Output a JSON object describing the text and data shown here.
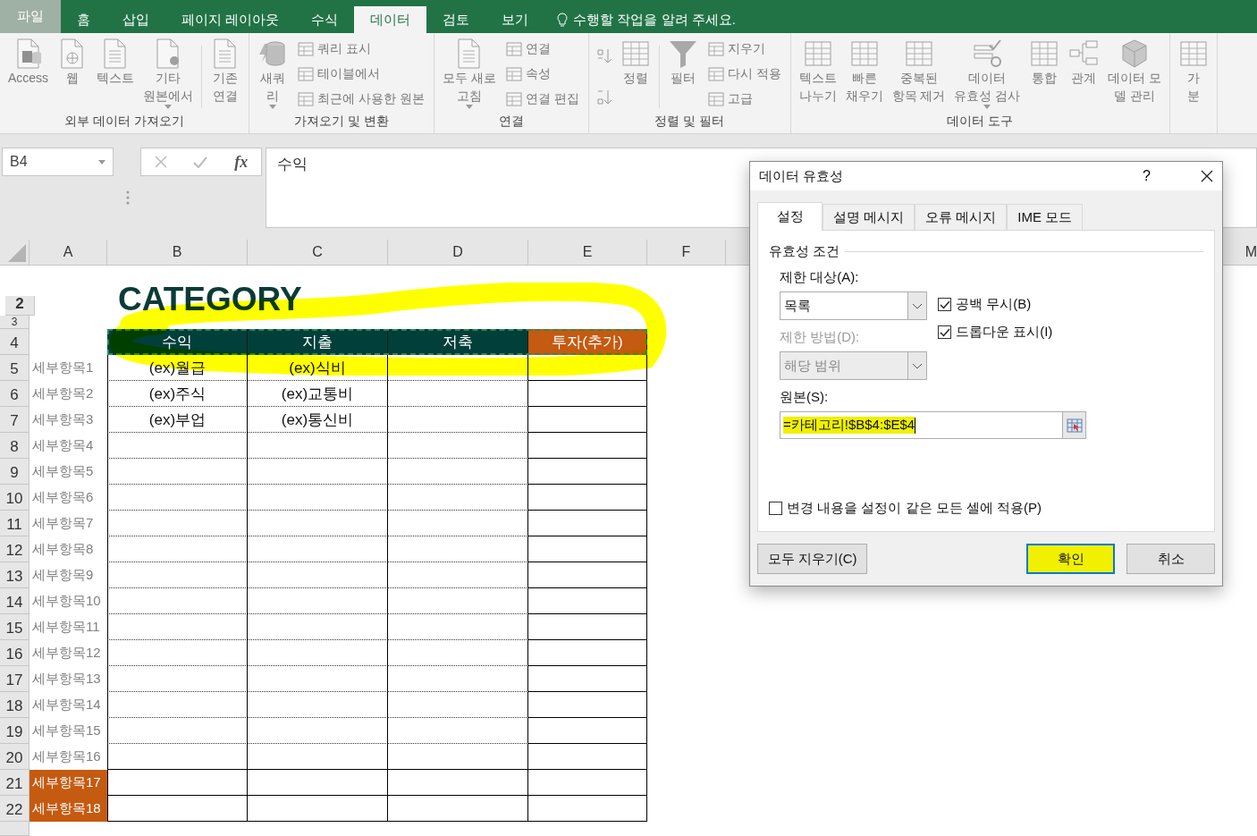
{
  "tabs": [
    {
      "label": "파일",
      "kind": "file",
      "selected": false
    },
    {
      "label": "홈",
      "kind": "tab",
      "selected": false
    },
    {
      "label": "삽입",
      "kind": "tab",
      "selected": false
    },
    {
      "label": "페이지 레이아웃",
      "kind": "tab",
      "selected": false
    },
    {
      "label": "수식",
      "kind": "tab",
      "selected": false
    },
    {
      "label": "데이터",
      "kind": "tab",
      "selected": true
    },
    {
      "label": "검토",
      "kind": "tab",
      "selected": false
    },
    {
      "label": "보기",
      "kind": "tab",
      "selected": false
    }
  ],
  "tell_me": {
    "placeholder": "수행할 작업을 알려 주세요."
  },
  "ribbon": {
    "groups": [
      {
        "label": "외부 데이터 가져오기",
        "items": [
          {
            "kind": "large",
            "label": "Access",
            "dropdown": false
          },
          {
            "kind": "large",
            "label": "웹",
            "dropdown": false
          },
          {
            "kind": "large",
            "label": "텍스트",
            "dropdown": false
          },
          {
            "kind": "large",
            "label": "기타\n원본에서",
            "dropdown": true
          },
          {
            "kind": "separator"
          },
          {
            "kind": "large",
            "label": "기존\n연결",
            "dropdown": false
          }
        ]
      },
      {
        "label": "가져오기 및 변환",
        "items": [
          {
            "kind": "large",
            "label": "새쿼\n리",
            "dropdown": true
          },
          {
            "kind": "stack",
            "items": [
              {
                "label": "쿼리 표시"
              },
              {
                "label": "테이블에서"
              },
              {
                "label": "최근에 사용한 원본"
              }
            ]
          }
        ]
      },
      {
        "label": "연결",
        "items": [
          {
            "kind": "large",
            "label": "모두 새로\n고침",
            "dropdown": true
          },
          {
            "kind": "stack",
            "items": [
              {
                "label": "연결"
              },
              {
                "label": "속성"
              },
              {
                "label": "연결 편집"
              }
            ]
          }
        ]
      },
      {
        "label": "정렬 및 필터",
        "items": [
          {
            "kind": "sort_pair"
          },
          {
            "kind": "large",
            "label": "정렬",
            "dropdown": false
          },
          {
            "kind": "separator"
          },
          {
            "kind": "large",
            "label": "필터",
            "dropdown": false
          },
          {
            "kind": "stack",
            "items": [
              {
                "label": "지우기"
              },
              {
                "label": "다시 적용"
              },
              {
                "label": "고급"
              }
            ]
          }
        ]
      },
      {
        "label": "데이터 도구",
        "items": [
          {
            "kind": "large",
            "label": "텍스트\n나누기",
            "dropdown": false
          },
          {
            "kind": "large",
            "label": "빠른\n채우기",
            "dropdown": false
          },
          {
            "kind": "large",
            "label": "중복된\n항목 제거",
            "dropdown": false
          },
          {
            "kind": "large",
            "label": "데이터\n유효성 검사",
            "dropdown": true
          },
          {
            "kind": "large",
            "label": "통합",
            "dropdown": false
          },
          {
            "kind": "large",
            "label": "관계",
            "dropdown": false
          },
          {
            "kind": "large",
            "label": "데이터 모\n델 관리",
            "dropdown": false
          }
        ]
      },
      {
        "items": [
          {
            "kind": "large",
            "label": "가\n분",
            "dropdown": false
          }
        ]
      }
    ]
  },
  "formula_bar": {
    "name_box": "B4",
    "function_label": "fx",
    "value": "수익"
  },
  "sheet": {
    "header_marquee": true,
    "header_highlighted": true,
    "columns": [
      "A",
      "B",
      "C",
      "D",
      "E",
      "F",
      "M"
    ],
    "rows": [
      {
        "number": "2",
        "kind": "title",
        "cells": [
          {},
          {
            "text": "CATEGORY"
          }
        ]
      },
      {
        "number": "3",
        "kind": "spacer"
      },
      {
        "number": "4",
        "kind": "header",
        "cells": [
          {},
          {
            "text": "수익",
            "color": "#003f3a"
          },
          {
            "text": "지출",
            "color": "#003f3a"
          },
          {
            "text": "저축",
            "color": "#003f3a"
          },
          {
            "text": "투자(추가)",
            "color": "#c55a11"
          }
        ]
      },
      {
        "number": "5",
        "kind": "item",
        "cells": [
          {
            "text": "세부항목1"
          },
          {
            "text": "(ex)월급"
          },
          {
            "text": "(ex)식비"
          },
          {},
          {}
        ]
      },
      {
        "number": "6",
        "kind": "item",
        "cells": [
          {
            "text": "세부항목2"
          },
          {
            "text": "(ex)주식"
          },
          {
            "text": "(ex)교통비"
          },
          {},
          {}
        ]
      },
      {
        "number": "7",
        "kind": "item",
        "cells": [
          {
            "text": "세부항목3"
          },
          {
            "text": "(ex)부업"
          },
          {
            "text": "(ex)통신비"
          },
          {},
          {}
        ]
      },
      {
        "number": "8",
        "kind": "item",
        "cells": [
          {
            "text": "세부항목4"
          },
          {},
          {},
          {},
          {}
        ]
      },
      {
        "number": "9",
        "kind": "item",
        "cells": [
          {
            "text": "세부항목5"
          },
          {},
          {},
          {},
          {}
        ]
      },
      {
        "number": "10",
        "kind": "item",
        "cells": [
          {
            "text": "세부항목6"
          },
          {},
          {},
          {},
          {}
        ]
      },
      {
        "number": "11",
        "kind": "item",
        "cells": [
          {
            "text": "세부항목7"
          },
          {},
          {},
          {},
          {}
        ]
      },
      {
        "number": "12",
        "kind": "item",
        "cells": [
          {
            "text": "세부항목8"
          },
          {},
          {},
          {},
          {}
        ]
      },
      {
        "number": "13",
        "kind": "item",
        "cells": [
          {
            "text": "세부항목9"
          },
          {},
          {},
          {},
          {}
        ]
      },
      {
        "number": "14",
        "kind": "item",
        "cells": [
          {
            "text": "세부항목10"
          },
          {},
          {},
          {},
          {}
        ]
      },
      {
        "number": "15",
        "kind": "item",
        "cells": [
          {
            "text": "세부항목11"
          },
          {},
          {},
          {},
          {}
        ]
      },
      {
        "number": "16",
        "kind": "item",
        "cells": [
          {
            "text": "세부항목12"
          },
          {},
          {},
          {},
          {}
        ]
      },
      {
        "number": "17",
        "kind": "item",
        "cells": [
          {
            "text": "세부항목13"
          },
          {},
          {},
          {},
          {}
        ]
      },
      {
        "number": "18",
        "kind": "item",
        "cells": [
          {
            "text": "세부항목14"
          },
          {},
          {},
          {},
          {}
        ]
      },
      {
        "number": "19",
        "kind": "item",
        "cells": [
          {
            "text": "세부항목15"
          },
          {},
          {},
          {},
          {}
        ]
      },
      {
        "number": "20",
        "kind": "item",
        "cells": [
          {
            "text": "세부항목16"
          },
          {},
          {},
          {},
          {}
        ]
      },
      {
        "number": "21",
        "kind": "item",
        "cells": [
          {
            "text": "세부항목17",
            "color": "#c55a11"
          },
          {},
          {},
          {},
          {}
        ]
      },
      {
        "number": "22",
        "kind": "item",
        "cells": [
          {
            "text": "세부항목18",
            "color": "#c55a11"
          },
          {},
          {},
          {},
          {}
        ]
      },
      {
        "kind": "blank"
      }
    ]
  },
  "dialog": {
    "title": "데이터 유효성",
    "help": "?",
    "tabs": [
      {
        "label": "설정",
        "selected": true
      },
      {
        "label": "설명 메시지",
        "selected": false
      },
      {
        "label": "오류 메시지",
        "selected": false
      },
      {
        "label": "IME 모드",
        "selected": false
      }
    ],
    "section": "유효성 조건",
    "allow": {
      "label": "제한 대상(A):",
      "value": "목록",
      "disabled": false
    },
    "data": {
      "label": "제한 방법(D):",
      "value": "해당 범위",
      "disabled": true
    },
    "checkboxes": [
      {
        "label": "공백 무시(B)",
        "checked": true
      },
      {
        "label": "드롭다운 표시(I)",
        "checked": true
      }
    ],
    "source": {
      "label": "원본(S):",
      "value": "=카테고리!$B$4:$E$4",
      "highlighted": true
    },
    "apply": {
      "label": "변경 내용을 설정이 같은 모든 셀에 적용(P)",
      "checked": false
    },
    "buttons": [
      {
        "label": "모두 지우기(C)",
        "kind": "secondary",
        "highlighted": false
      },
      {
        "label": "확인",
        "kind": "default",
        "highlighted": true
      },
      {
        "label": "취소",
        "kind": "secondary",
        "highlighted": false
      }
    ]
  }
}
